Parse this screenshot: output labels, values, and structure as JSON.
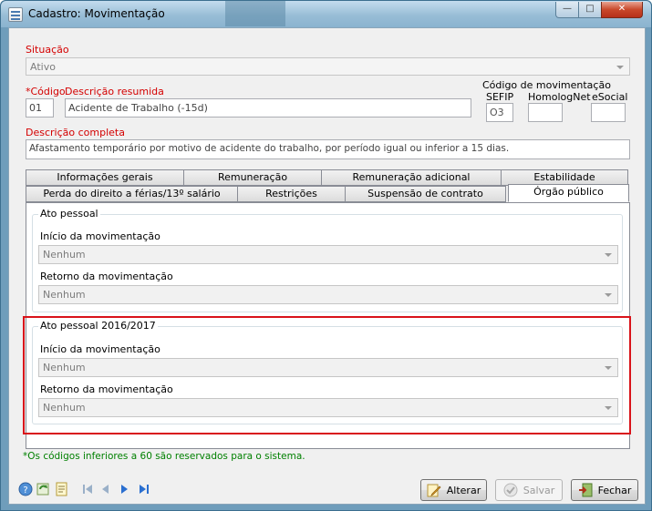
{
  "window": {
    "title": "Cadastro: Movimentação"
  },
  "titlebar_buttons": {
    "minimize": "—",
    "maximize": "□",
    "close": "✕"
  },
  "situacao": {
    "label": "Situação",
    "value": "Ativo"
  },
  "codigo": {
    "label": "*Código",
    "value": "01"
  },
  "descricao_resumida": {
    "label": "Descrição resumida",
    "value": "Acidente de Trabalho (-15d)"
  },
  "codigo_movimentacao": {
    "title": "Código de movimentação",
    "sefip_label": "SEFIP",
    "sefip_value": "O3",
    "homolognet_label": "HomologNet",
    "homolognet_value": "",
    "esocial_label": "eSocial",
    "esocial_value": ""
  },
  "descricao_completa": {
    "label": "Descrição completa",
    "value": "Afastamento temporário por motivo de acidente do trabalho, por período igual ou inferior a 15 dias."
  },
  "tabs_row1": [
    "Informações gerais",
    "Remuneração",
    "Remuneração adicional",
    "Estabilidade"
  ],
  "tabs_row2": [
    "Perda do direito a férias/13º salário",
    "Restrições",
    "Suspensão de contrato",
    "Órgão público"
  ],
  "ato_pessoal": {
    "title": "Ato pessoal",
    "inicio_label": "Início da movimentação",
    "inicio_value": "Nenhum",
    "retorno_label": "Retorno da movimentação",
    "retorno_value": "Nenhum"
  },
  "ato_pessoal_2016": {
    "title": "Ato pessoal 2016/2017",
    "inicio_label": "Início da movimentação",
    "inicio_value": "Nenhum",
    "retorno_label": "Retorno da movimentação",
    "retorno_value": "Nenhum"
  },
  "footer_note": "*Os códigos inferiores a 60 são reservados para o sistema.",
  "buttons": {
    "alterar": "Alterar",
    "salvar": "Salvar",
    "fechar": "Fechar"
  },
  "colors": {
    "required_label": "#d40000",
    "note_green": "#008000",
    "highlight_border": "#d9131a"
  }
}
